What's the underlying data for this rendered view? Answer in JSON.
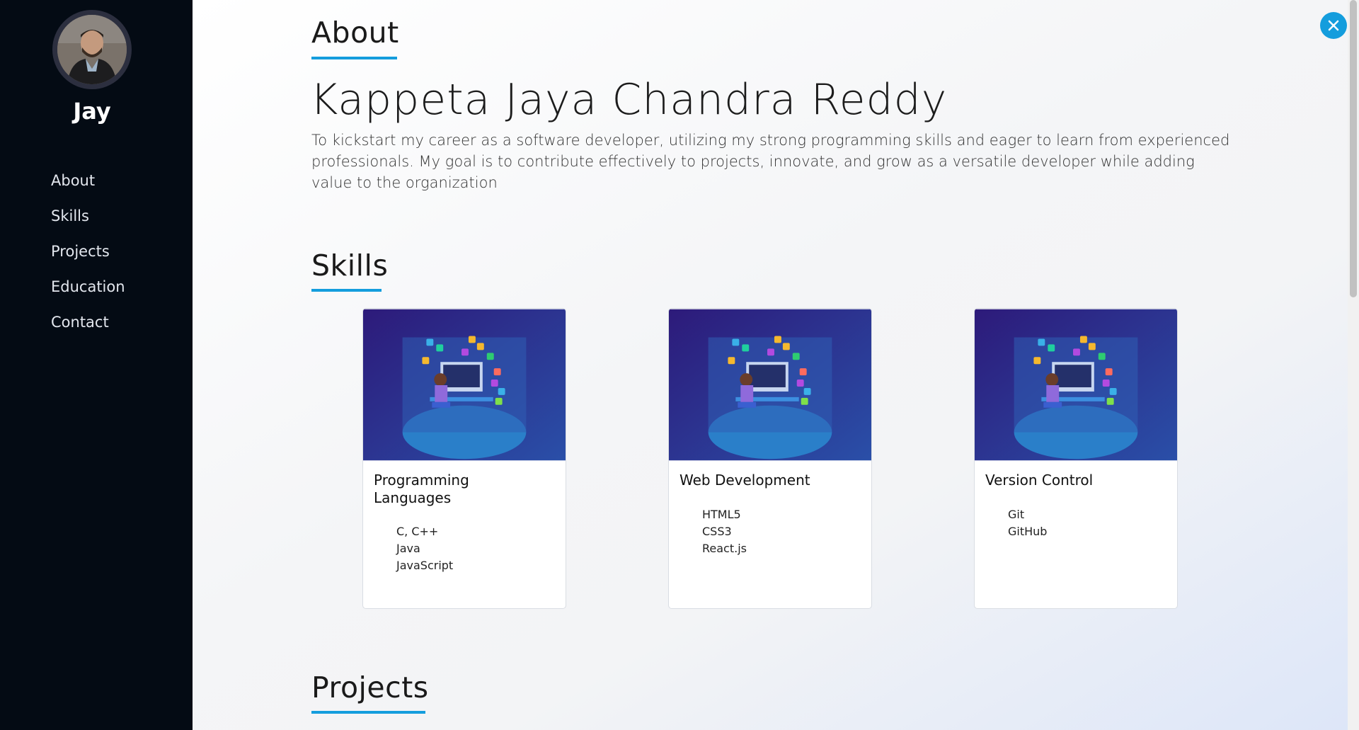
{
  "sidebar": {
    "name": "Jay",
    "nav": [
      "About",
      "Skills",
      "Projects",
      "Education",
      "Contact"
    ]
  },
  "about": {
    "title": "About",
    "full_name": "Kappeta Jaya Chandra Reddy",
    "description": "To kickstart my career as a software developer, utilizing my strong programming skills and eager to learn from experienced professionals. My goal is to contribute effectively to projects, innovate, and grow as a versatile developer while adding value to the organization"
  },
  "skills": {
    "title": "Skills",
    "cards": [
      {
        "title": "Programming Languages",
        "items": [
          "C, C++",
          "Java",
          "JavaScript"
        ]
      },
      {
        "title": "Web Development",
        "items": [
          "HTML5",
          "CSS3",
          "React.js"
        ]
      },
      {
        "title": "Version Control",
        "items": [
          "Git",
          "GitHub"
        ]
      }
    ]
  },
  "projects": {
    "title": "Projects"
  },
  "close_icon": "close-icon",
  "colors": {
    "accent": "#149ddd",
    "sidebar": "#040b14"
  }
}
